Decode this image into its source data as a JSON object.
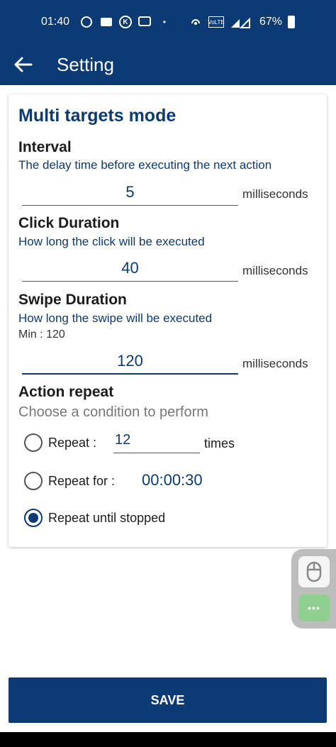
{
  "status_bar": {
    "time": "01:40",
    "battery": "67%",
    "network": "4G"
  },
  "app_bar": {
    "title": "Setting"
  },
  "multi_targets": {
    "title": "Multi targets mode",
    "interval": {
      "label": "Interval",
      "description": "The delay time before executing the next action",
      "value": "5",
      "unit": "milliseconds"
    },
    "click_duration": {
      "label": "Click Duration",
      "description": "How long the click will be executed",
      "value": "40",
      "unit": "milliseconds"
    },
    "swipe_duration": {
      "label": "Swipe Duration",
      "description": "How long the swipe will be executed",
      "min": "Min : 120",
      "value": "120",
      "unit": "milliseconds"
    },
    "action_repeat": {
      "label": "Action repeat",
      "description": "Choose a condition to perform",
      "repeat_label": "Repeat :",
      "repeat_value": "12",
      "times_label": "times",
      "repeat_for_label": "Repeat for :",
      "repeat_for_value": "00:00:30",
      "repeat_until_label": "Repeat until stopped",
      "selected": "repeat_until_stopped"
    }
  },
  "floating_panel": {
    "more_label": "•••"
  },
  "save_button": {
    "label": "SAVE"
  },
  "colors": {
    "primary": "#0b3a75",
    "float_green": "#8fcf8f"
  }
}
